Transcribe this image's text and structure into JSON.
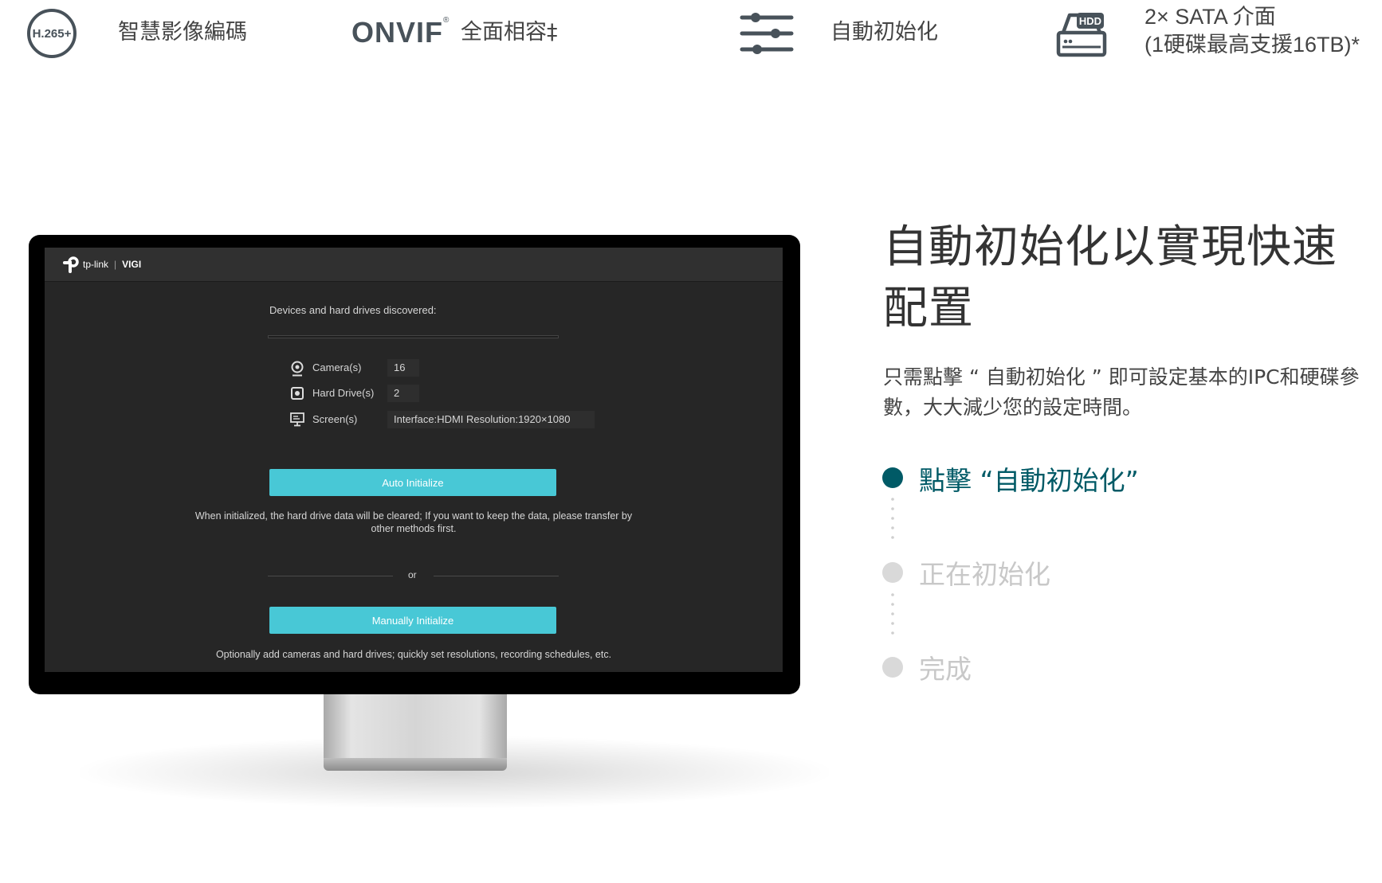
{
  "features": [
    {
      "icon": "h265-icon",
      "badge": "H.265+",
      "label": "智慧影像編碼"
    },
    {
      "icon": "onvif-logo",
      "logo": "ONVIF",
      "label": "全面相容‡"
    },
    {
      "icon": "sliders-icon",
      "label": "自動初始化"
    },
    {
      "icon": "hdd-icon",
      "badge": "HDD",
      "label_line1": "2× SATA 介面",
      "label_line2": "(1硬碟最高支援16TB)*"
    }
  ],
  "monitor": {
    "brand": {
      "name": "tp-link",
      "product": "VIGI"
    },
    "heading": "Devices and hard drives discovered:",
    "rows": [
      {
        "icon": "camera-icon",
        "label": "Camera(s)",
        "value": "16"
      },
      {
        "icon": "hard-drive-icon",
        "label": "Hard Drive(s)",
        "value": "2"
      },
      {
        "icon": "screen-icon",
        "label": "Screen(s)",
        "value": "Interface:HDMI Resolution:1920×1080"
      }
    ],
    "auto_button": "Auto Initialize",
    "auto_note": "When initialized, the hard drive data will be cleared; If you want to keep the data, please transfer by other methods first.",
    "or_text": "or",
    "manual_button": "Manually Initialize",
    "manual_note": "Optionally add cameras and hard drives; quickly set resolutions, recording schedules, etc."
  },
  "content": {
    "headline_line1": "自動初始化以實現快速",
    "headline_line2": "配置",
    "description": "只需點擊 “ 自動初始化 ” 即可設定基本的IPC和硬碟參數，大大減少您的設定時間。",
    "steps": [
      {
        "label": "點擊 “自動初始化”",
        "active": true
      },
      {
        "label": "正在初始化",
        "active": false
      },
      {
        "label": "完成",
        "active": false
      }
    ]
  },
  "colors": {
    "accent": "#005a66",
    "inactive": "#d9d9d9",
    "button": "#48c8d6"
  }
}
